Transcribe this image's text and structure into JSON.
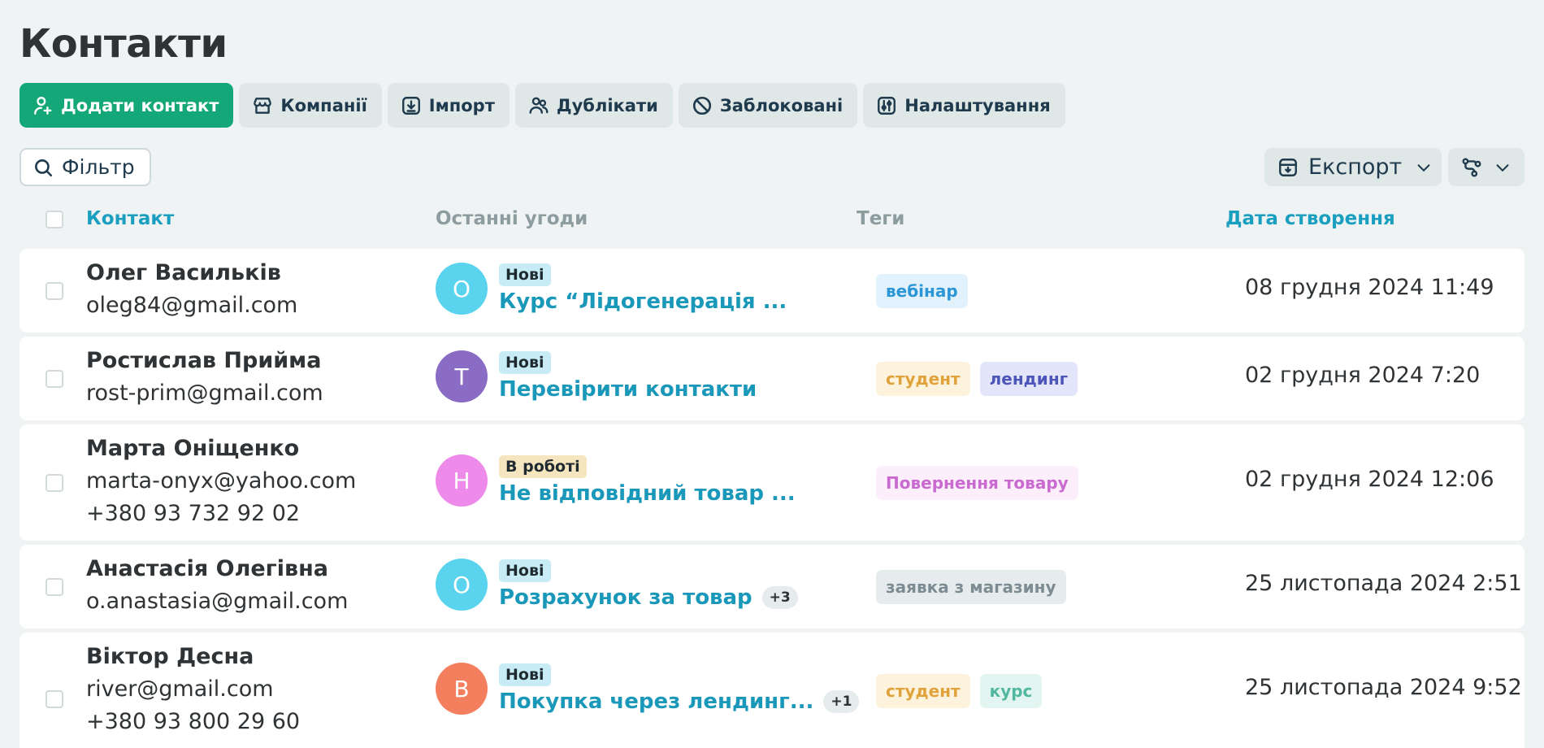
{
  "page": {
    "title": "Контакти"
  },
  "toolbar": {
    "add_contact": "Додати контакт",
    "companies": "Компанії",
    "import": "Імпорт",
    "duplicates": "Дублікати",
    "blocked": "Заблоковані",
    "settings": "Налаштування"
  },
  "filter": {
    "label": "Фільтр"
  },
  "export": {
    "label": "Експорт"
  },
  "columns": {
    "contact": "Контакт",
    "deals": "Останні угоди",
    "tags": "Теги",
    "created": "Дата створення"
  },
  "colors": {
    "primary": "#14a878",
    "accent": "#1a9fc0",
    "stage_new": "#c8ecf5",
    "stage_work": "#f6e6bf"
  },
  "rows": [
    {
      "name": "Олег Васильків",
      "email": "oleg84@gmail.com",
      "phone": "",
      "deal": {
        "avatar": "О",
        "avatar_color": "#5ad3ee",
        "stage": "Нові",
        "title": "Курс “Лідогенерація ...",
        "more": ""
      },
      "tags": [
        {
          "label": "вебінар",
          "bg": "#e2f2fc",
          "fg": "#2b96d6"
        }
      ],
      "date": "08 грудня 2024 11:49"
    },
    {
      "name": "Ростислав Прийма",
      "email": "rost-prim@gmail.com",
      "phone": "",
      "deal": {
        "avatar": "Т",
        "avatar_color": "#8a6cc4",
        "stage": "Нові",
        "title": "Перевірити контакти",
        "more": ""
      },
      "tags": [
        {
          "label": "студент",
          "bg": "#fdf3dc",
          "fg": "#e0a33b"
        },
        {
          "label": "лендинг",
          "bg": "#e3e5fb",
          "fg": "#4c55b8"
        }
      ],
      "date": "02 грудня 2024 7:20"
    },
    {
      "name": "Марта Оніщенко",
      "email": "marta-onyx@yahoo.com",
      "phone": "+380 93 732 92 02",
      "deal": {
        "avatar": "Н",
        "avatar_color": "#ee8aea",
        "stage": "В роботі",
        "title": "Не відповідний товар ...",
        "more": ""
      },
      "tags": [
        {
          "label": "Повернення товару",
          "bg": "#fdeefb",
          "fg": "#c86ad0"
        }
      ],
      "date": "02 грудня 2024 12:06"
    },
    {
      "name": "Анастасія Олегівна",
      "email": "o.anastasia@gmail.com",
      "phone": "",
      "deal": {
        "avatar": "О",
        "avatar_color": "#5ad3ee",
        "stage": "Нові",
        "title": "Розрахунок за товар",
        "more": "+3"
      },
      "tags": [
        {
          "label": "заявка з магазину",
          "bg": "#e6ecee",
          "fg": "#7c8c92"
        }
      ],
      "date": "25 листопада 2024 2:51"
    },
    {
      "name": "Віктор Десна",
      "email": "river@gmail.com",
      "phone": "+380 93 800 29 60",
      "deal": {
        "avatar": "В",
        "avatar_color": "#f47f5e",
        "stage": "Нові",
        "title": "Покупка через лендинг...",
        "more": "+1"
      },
      "tags": [
        {
          "label": "студент",
          "bg": "#fdf3dc",
          "fg": "#e0a33b"
        },
        {
          "label": "курс",
          "bg": "#e3f5f1",
          "fg": "#52b79f"
        }
      ],
      "date": "25 листопада 2024 9:52"
    }
  ]
}
